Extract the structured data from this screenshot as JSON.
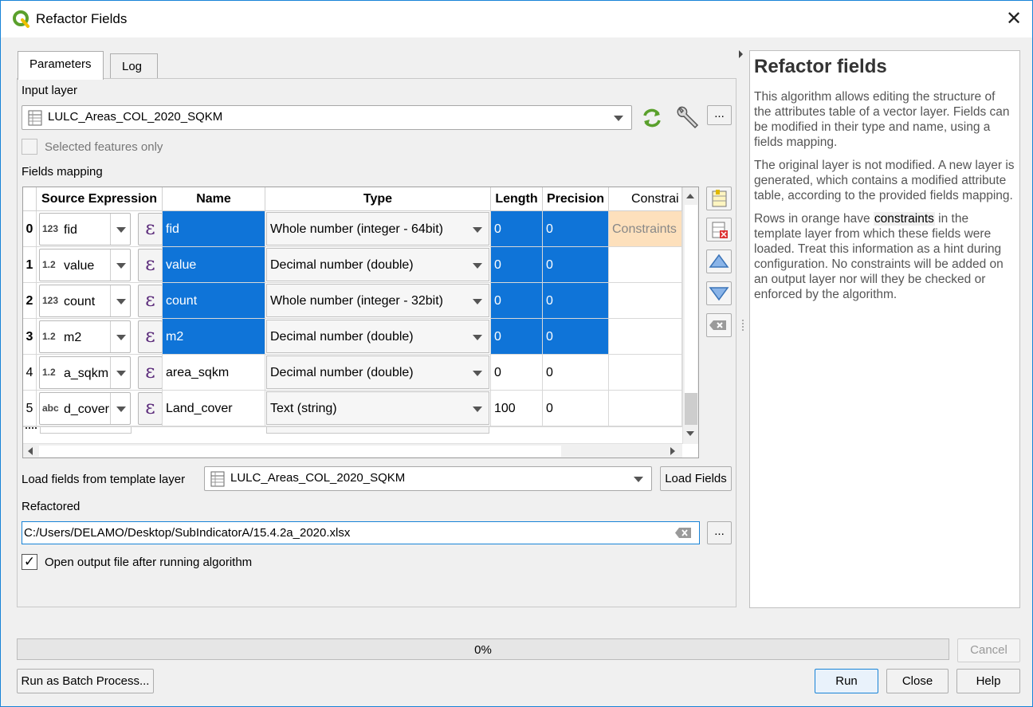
{
  "window": {
    "title": "Refactor Fields",
    "close_glyph": "✕"
  },
  "tabs": [
    {
      "label": "Parameters",
      "active": true
    },
    {
      "label": "Log",
      "active": false
    }
  ],
  "params": {
    "input_layer_label": "Input layer",
    "input_layer_value": "LULC_Areas_COL_2020_SQKM",
    "selected_only_label": "Selected features only",
    "selected_only_checked": false,
    "fields_mapping_label": "Fields mapping",
    "ellipsis": "...",
    "template_label": "Load fields from template layer",
    "template_value": "LULC_Areas_COL_2020_SQKM",
    "load_fields_button": "Load Fields",
    "refactored_label": "Refactored",
    "refactored_value": "C:/Users/DELAMO/Desktop/SubIndicatorA/15.4.2a_2020.xlsx",
    "open_output_label": "Open output file after running algorithm",
    "open_output_checked": true,
    "check_glyph": "✓"
  },
  "table": {
    "headers": [
      "Source Expression",
      "Name",
      "Type",
      "Length",
      "Precision",
      "Constrai"
    ],
    "epsilon": "ε",
    "rows": [
      {
        "num": "0",
        "badge": "123",
        "source": "fid",
        "name": "fid",
        "type": "Whole number (integer - 64bit)",
        "length": "0",
        "precision": "0",
        "constraint": "Constraints",
        "selected": true
      },
      {
        "num": "1",
        "badge": "1.2",
        "source": "value",
        "name": "value",
        "type": "Decimal number (double)",
        "length": "0",
        "precision": "0",
        "constraint": "",
        "selected": true
      },
      {
        "num": "2",
        "badge": "123",
        "source": "count",
        "name": "count",
        "type": "Whole number (integer - 32bit)",
        "length": "0",
        "precision": "0",
        "constraint": "",
        "selected": true
      },
      {
        "num": "3",
        "badge": "1.2",
        "source": "m2",
        "name": "m2",
        "type": "Decimal number (double)",
        "length": "0",
        "precision": "0",
        "constraint": "",
        "selected": true
      },
      {
        "num": "4",
        "badge": "1.2",
        "source": "a_sqkm",
        "name": "area_sqkm",
        "type": "Decimal number (double)",
        "length": "0",
        "precision": "0",
        "constraint": "",
        "selected": false
      },
      {
        "num": "5",
        "badge": "abc",
        "source": "d_cover",
        "name": "Land_cover",
        "type": "Text (string)",
        "length": "100",
        "precision": "0",
        "constraint": "",
        "selected": false
      }
    ]
  },
  "progress": {
    "value": 0,
    "text": "0%"
  },
  "buttons": {
    "cancel": "Cancel",
    "batch": "Run as Batch Process...",
    "run": "Run",
    "close": "Close",
    "help": "Help"
  },
  "help_panel": {
    "title": "Refactor fields",
    "p1": "This algorithm allows editing the structure of the attributes table of a vector layer. Fields can be modified in their type and name, using a fields mapping.",
    "p2": "The original layer is not modified. A new layer is generated, which contains a modified attribute table, according to the provided fields mapping.",
    "p3_before": "Rows in orange have ",
    "p3_keyword": "constraints",
    "p3_after": " in the template layer from which these fields were loaded. Treat this information as a hint during configuration. No constraints will be added on an output layer nor will they be checked or enforced by the algorithm."
  },
  "colors": {
    "selection": "#0f74d8",
    "constraint_bg": "#fde0bc",
    "qgis_green": "#5aa02c",
    "border_accent": "#1883d7"
  }
}
